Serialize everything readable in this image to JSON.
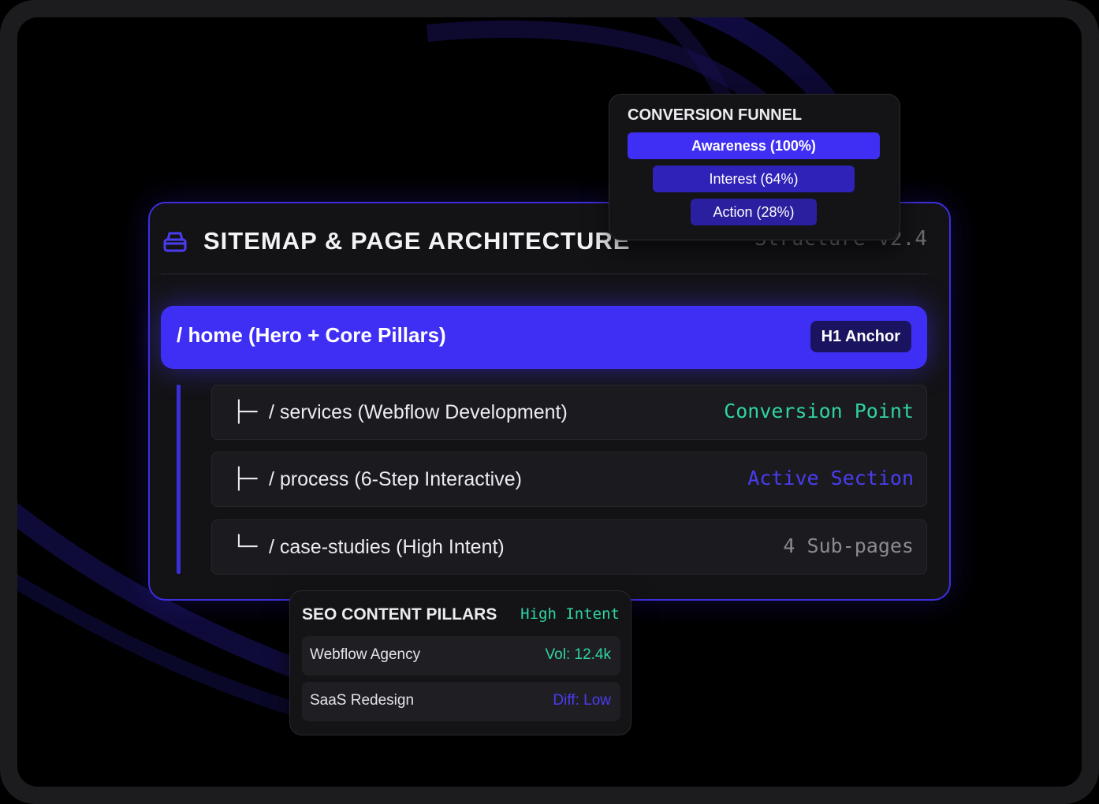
{
  "sitemap": {
    "title": "SITEMAP & PAGE ARCHITECTURE",
    "version": "Structure v2.4",
    "home": {
      "label": "/ home (Hero + Core Pillars)",
      "badge": "H1 Anchor"
    },
    "children": [
      {
        "glyph": "├─",
        "label": "/ services (Webflow Development)",
        "tag": "Conversion Point"
      },
      {
        "glyph": "├─",
        "label": "/ process (6-Step Interactive)",
        "tag": "Active Section"
      },
      {
        "glyph": "└─",
        "label": "/ case-studies (High Intent)",
        "tag": "4 Sub-pages"
      }
    ]
  },
  "funnel": {
    "title": "CONVERSION FUNNEL",
    "stages": [
      {
        "label": "Awareness (100%)",
        "value": 100
      },
      {
        "label": "Interest (64%)",
        "value": 64
      },
      {
        "label": "Action (28%)",
        "value": 28
      }
    ]
  },
  "seo": {
    "title": "SEO CONTENT PILLARS",
    "tag": "High Intent",
    "rows": [
      {
        "name": "Webflow Agency",
        "value": "Vol: 12.4k"
      },
      {
        "name": "SaaS Redesign",
        "value": "Diff: Low"
      }
    ]
  },
  "colors": {
    "accent": "#3f2ff5",
    "green": "#2fd3a4",
    "background": "#000000",
    "card": "#131316"
  },
  "icons": {
    "header": "stack-icon"
  }
}
